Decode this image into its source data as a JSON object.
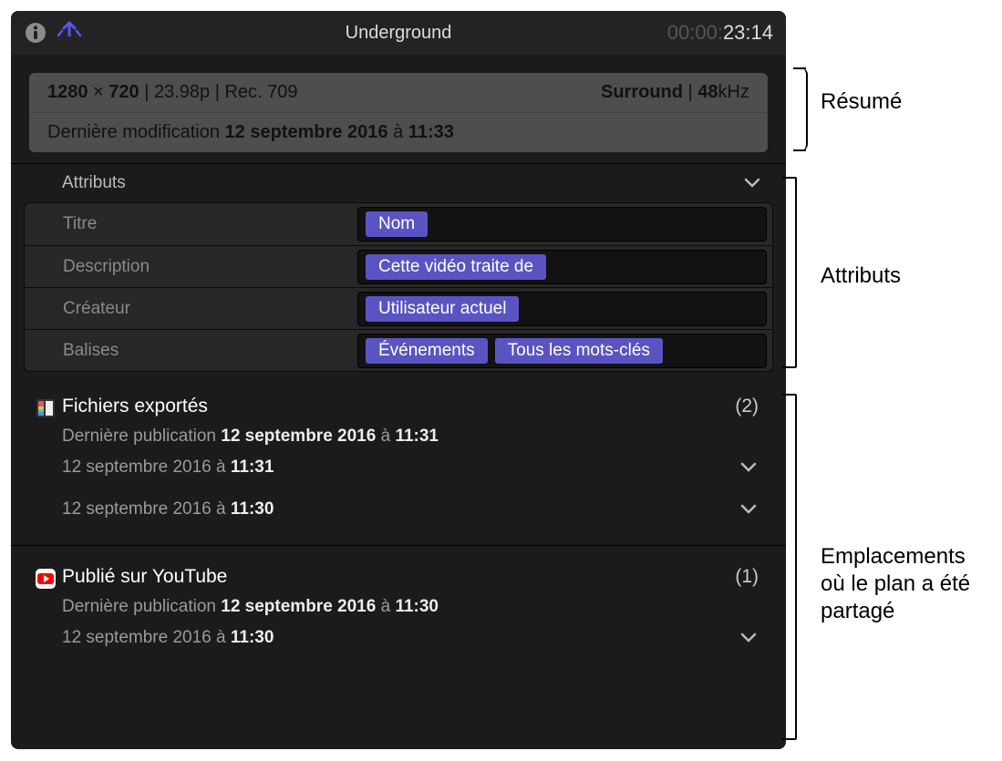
{
  "header": {
    "title": "Underground",
    "timecode_dim": "00:00:",
    "timecode": "23:14"
  },
  "summary": {
    "res_w": "1280",
    "res_h": "720",
    "sep1": " | ",
    "fps": "23.98p",
    "sep2": " | ",
    "colorspace": "Rec. 709",
    "audio": "Surround",
    "sep3": " | ",
    "khz": "48",
    "khz_unit": "kHz",
    "mod_label": "Dernière modification ",
    "mod_date": "12 septembre 2016",
    "mod_at": " à ",
    "mod_time": "11:33"
  },
  "attributes": {
    "header": "Attributs",
    "rows": [
      {
        "label": "Titre",
        "chips": [
          "Nom"
        ]
      },
      {
        "label": "Description",
        "chips": [
          "Cette vidéo traite de"
        ]
      },
      {
        "label": "Créateur",
        "chips": [
          "Utilisateur actuel"
        ]
      },
      {
        "label": "Balises",
        "chips": [
          "Événements",
          "Tous les mots-clés"
        ]
      }
    ]
  },
  "shares": [
    {
      "title": "Fichiers exportés",
      "count": "(2)",
      "last_label": "Dernière publication ",
      "last_date": "12 septembre 2016",
      "last_at": " à ",
      "last_time": "11:31",
      "entries": [
        {
          "date": "12 septembre 2016",
          "at": " à ",
          "time": "11:31"
        },
        {
          "date": "12 septembre 2016",
          "at": " à ",
          "time": "11:30"
        }
      ]
    },
    {
      "title": "Publié sur YouTube",
      "count": "(1)",
      "last_label": "Dernière publication ",
      "last_date": "12 septembre 2016",
      "last_at": " à ",
      "last_time": "11:30",
      "entries": [
        {
          "date": "12 septembre 2016",
          "at": " à ",
          "time": "11:30"
        }
      ]
    }
  ],
  "annotations": {
    "summary": "Résumé",
    "attributes": "Attributs",
    "shares": "Emplacements où le plan a été partagé"
  }
}
